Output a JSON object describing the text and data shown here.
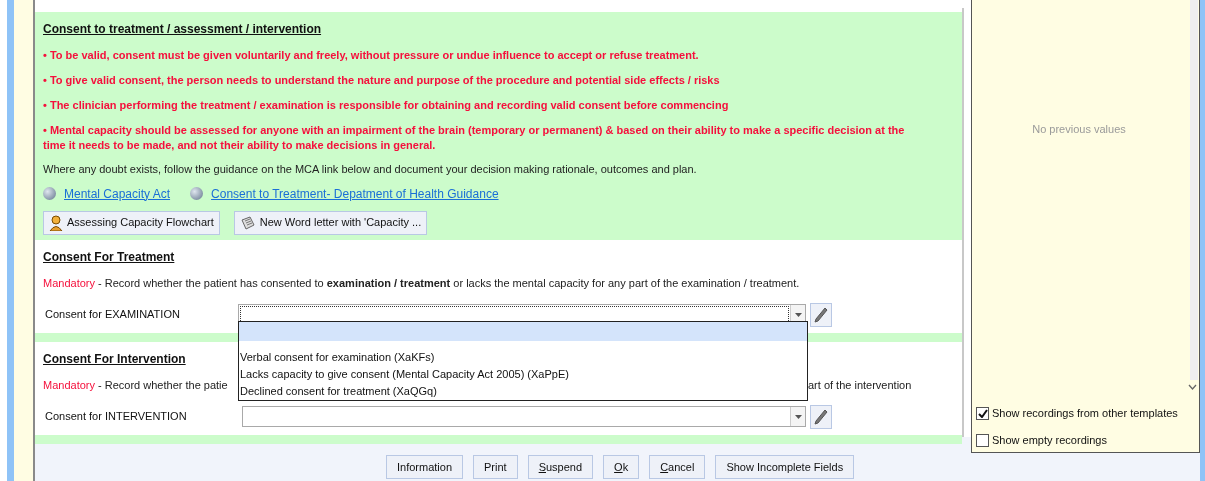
{
  "consent_info": {
    "title": "Consent to treatment / assessment / intervention",
    "bullets": [
      "• To be valid, consent must be given voluntarily and freely, without pressure or undue influence to accept or refuse treatment.",
      "• To give valid consent, the person needs to understand the nature and purpose of the procedure and potential side effects / risks",
      "• The clinician performing the treatment / examination is responsible for obtaining and recording valid consent before commencing",
      "• Mental capacity should be assessed for anyone with an impairment of the brain (temporary or permanent) & based on their ability to make a specific decision at the time it needs to be made, and not their ability to make decisions in general."
    ],
    "guidance": "Where any doubt exists, follow the guidance on the MCA link below and document your decision making rationale, outcomes and plan.",
    "links": [
      "Mental Capacity Act",
      "Consent to Treatment- Depatment of Health Guidance"
    ],
    "buttons": [
      {
        "kind": "flowchart",
        "label": "Assessing Capacity Flowchart"
      },
      {
        "kind": "letter",
        "label": "New Word letter with 'Capacity ..."
      }
    ]
  },
  "consent_treatment": {
    "title": "Consent For Treatment",
    "mandatory_label": "Mandatory",
    "mandatory_text": " - Record whether the patient has consented to **examination / treatment** or lacks the mental capacity for any part of the examination / treatment.",
    "field_label": "Consent for EXAMINATION",
    "focused": true,
    "dropdown": {
      "blank_row_selected": true,
      "options": [
        {
          "label": "Verbal consent for examination (XaKFs)",
          "selected": false
        },
        {
          "label": "Lacks capacity to give consent (Mental Capacity Act 2005) (XaPpE)",
          "selected": false
        },
        {
          "label": "Declined consent for treatment (XaQGq)",
          "selected": false
        }
      ]
    }
  },
  "consent_intervention": {
    "title": "Consent For Intervention",
    "mandatory_label": "Mandatory",
    "mandatory_text_visible": " - Record whether the patie",
    "mandatory_text_tail": "art of the intervention",
    "field_label": "Consent for INTERVENTION",
    "focused": false
  },
  "previous_values": {
    "message": "No previous values",
    "checkboxes": [
      {
        "label": "Show recordings from other templates",
        "checked": true
      },
      {
        "label": "Show empty recordings",
        "checked": false
      }
    ]
  },
  "footer_buttons": [
    {
      "label": "Information",
      "underline_first": false
    },
    {
      "label": "Print",
      "underline_first": false
    },
    {
      "label": "Suspend",
      "underline_first": true
    },
    {
      "label": "Ok",
      "underline_first": true
    },
    {
      "label": "Cancel",
      "underline_first": true
    },
    {
      "label": "Show Incomplete Fields",
      "underline_first": false
    }
  ]
}
